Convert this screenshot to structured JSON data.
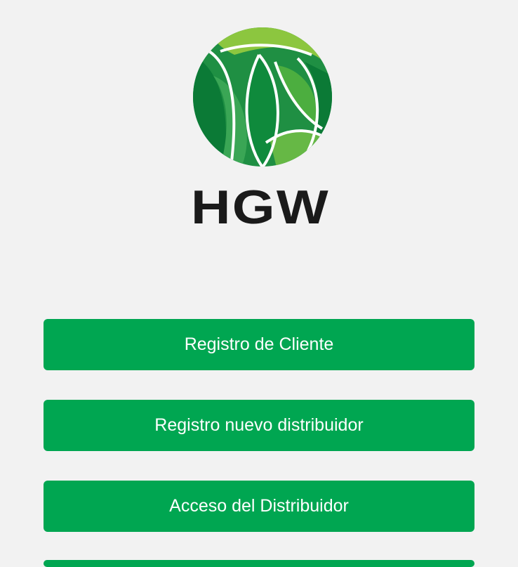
{
  "brand": {
    "logo_text": "HGW",
    "colors": {
      "leaf_dark": "#0b7a36",
      "leaf_mid": "#2e9e48",
      "leaf_light": "#8cc63f",
      "wordmark": "#1a1a1a"
    }
  },
  "buttons": {
    "registro_cliente": "Registro de Cliente",
    "registro_distribuidor": "Registro nuevo distribuidor",
    "acceso_distribuidor": "Acceso del Distribuidor"
  },
  "colors": {
    "background": "#f2f2f2",
    "button": "#00a651",
    "button_text": "#ffffff"
  }
}
